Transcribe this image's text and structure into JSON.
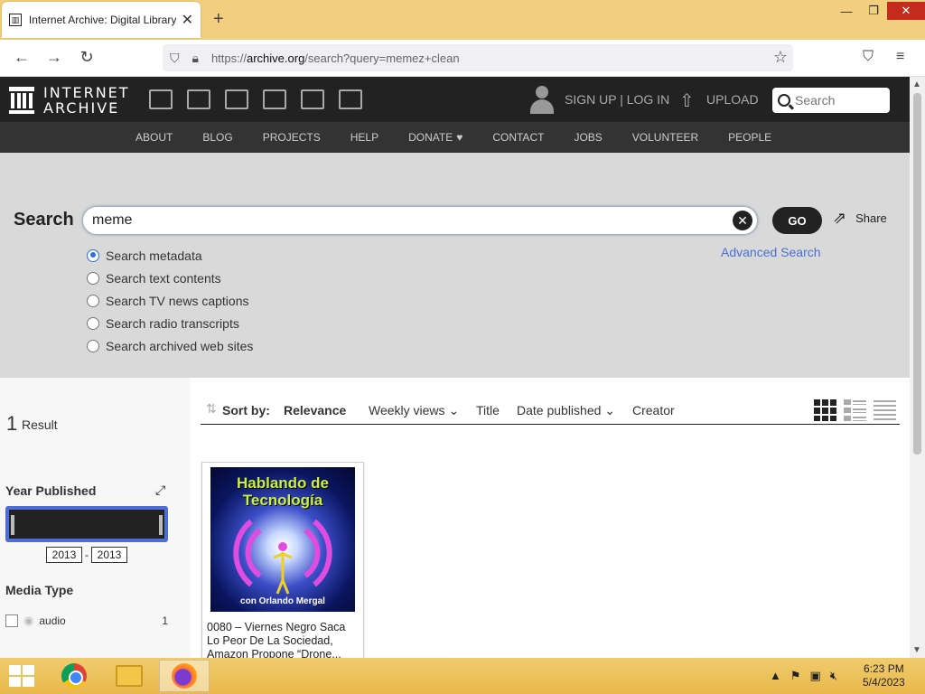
{
  "browser": {
    "tab_title": "Internet Archive: Digital Library",
    "new_tab": "+",
    "url_prefix": "https://",
    "url_domain": "archive.org",
    "url_path": "/search?query=memez+clean"
  },
  "ia_header": {
    "logo_line1": "INTERNET",
    "logo_line2": "ARCHIVE",
    "signup": "SIGN UP | LOG IN",
    "upload": "UPLOAD",
    "search_placeholder": "Search"
  },
  "ia_nav": [
    "ABOUT",
    "BLOG",
    "PROJECTS",
    "HELP",
    "DONATE",
    "CONTACT",
    "JOBS",
    "VOLUNTEER",
    "PEOPLE"
  ],
  "search": {
    "label": "Search",
    "query": "meme",
    "go": "GO",
    "share": "Share",
    "advanced": "Advanced Search",
    "options": [
      "Search metadata",
      "Search text contents",
      "Search TV news captions",
      "Search radio transcripts",
      "Search archived web sites"
    ],
    "selected_option": "Search metadata"
  },
  "sidebar": {
    "result_count": "1",
    "result_label": "Result",
    "year_title": "Year Published",
    "year_from": "2013",
    "year_to": "2013",
    "year_sep": "-",
    "media_title": "Media Type",
    "media_items": [
      {
        "label": "audio",
        "count": "1"
      }
    ]
  },
  "sort": {
    "label": "Sort by:",
    "options": [
      "Relevance",
      "Weekly views",
      "Title",
      "Date published",
      "Creator"
    ]
  },
  "result_card": {
    "image_title": "Hablando de Tecnología",
    "image_subtitle": "con Orlando Mergal",
    "caption": "0080 – Viernes Negro Saca Lo Peor De La Sociedad, Amazon Propone “Drone..."
  },
  "taskbar": {
    "time": "6:23 PM",
    "date": "5/4/2023"
  },
  "colors": {
    "tabbar": "#f2cf7f",
    "ia_header": "#222222",
    "accent_blue": "#4b6fd6",
    "search_area": "#d9d9d9"
  }
}
